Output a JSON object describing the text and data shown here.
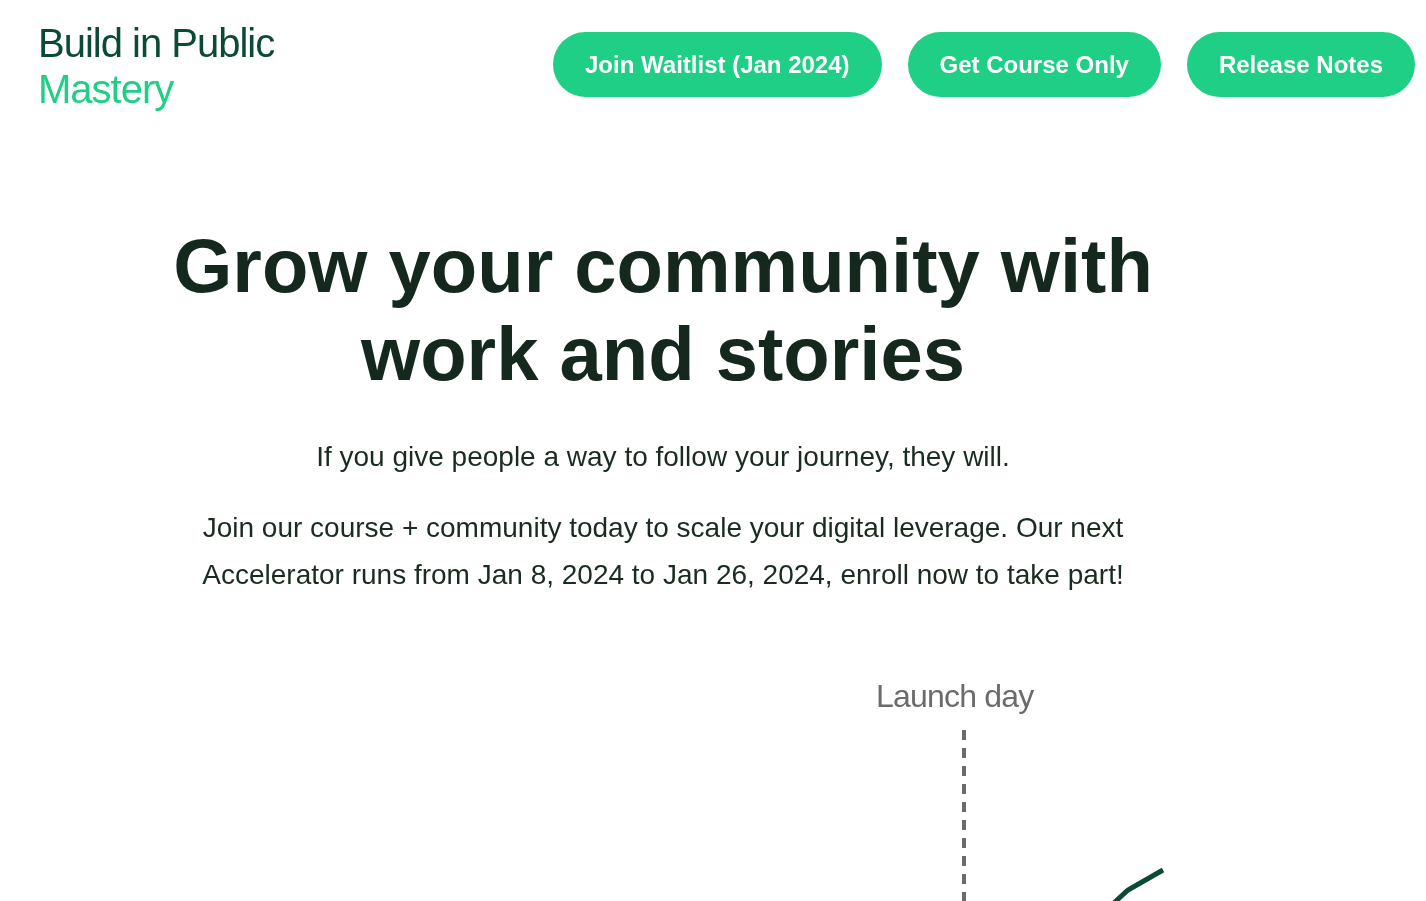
{
  "logo": {
    "line_1": "Build in Public",
    "line_2": "Mastery"
  },
  "nav": {
    "buttons": [
      "Join Waitlist (Jan 2024)",
      "Get Course Only",
      "Release Notes"
    ]
  },
  "hero": {
    "heading_lines": [
      "Grow your community with",
      "work and stories"
    ],
    "tagline": "If you give people a way to follow your journey, they will.",
    "body_lines": [
      "Join our course + community today to scale your digital leverage. Our next",
      "Accelerator runs from Jan 8, 2024 to Jan 26, 2024, enroll now to take part!"
    ]
  },
  "illustration": {
    "marker_label": "Launch day"
  }
}
